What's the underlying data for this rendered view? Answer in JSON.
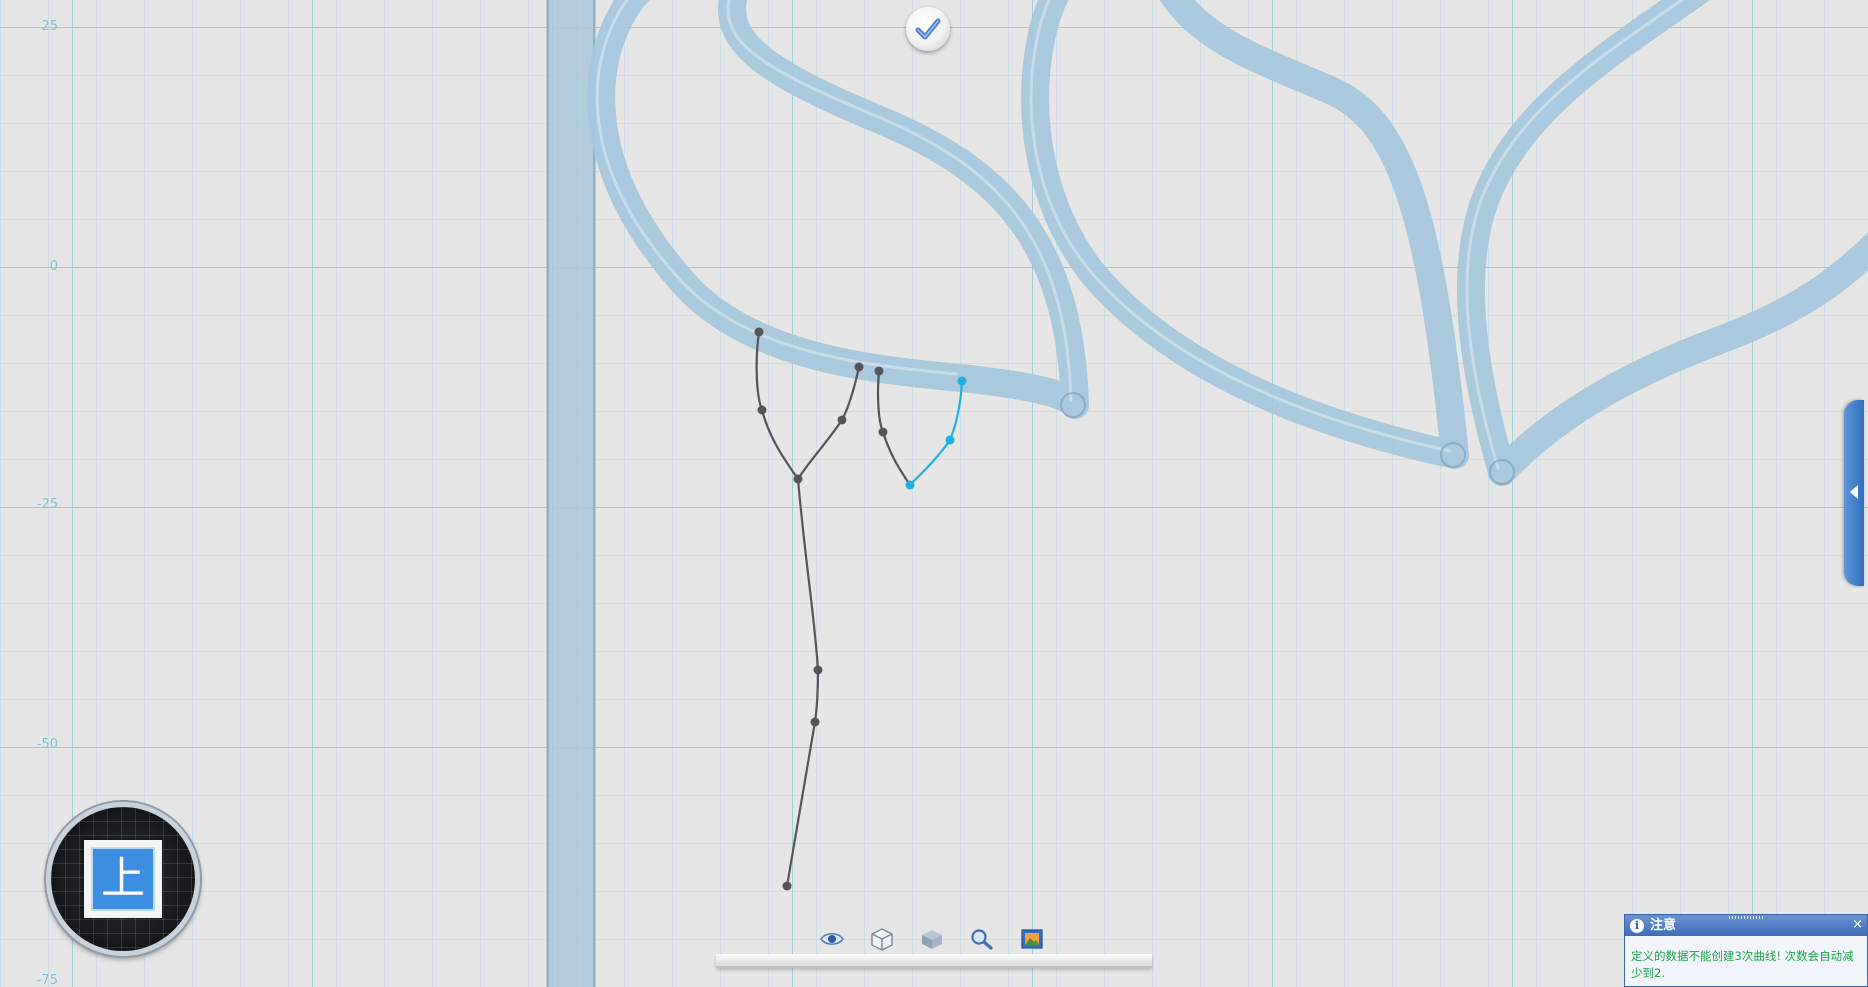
{
  "canvas": {
    "axis_labels": [
      "25",
      "0",
      "-25",
      "-50",
      "-75"
    ],
    "grid_color": "#9fd3e4",
    "major_grid_color": "#7fc6dc",
    "background_color": "#e6e6e6",
    "tube_color": "#a8c8dd",
    "sketch_color": "#555555",
    "active_curve_color": "#1ab3e0"
  },
  "confirm_button": {
    "icon": "checkmark-icon"
  },
  "view_cube": {
    "face_label": "上"
  },
  "toolbar": {
    "tools": [
      {
        "name": "view-eye-tool",
        "icon": "eye-icon"
      },
      {
        "name": "wireframe-cube-tool",
        "icon": "wireframe-cube-icon"
      },
      {
        "name": "solid-cube-tool",
        "icon": "solid-cube-icon"
      },
      {
        "name": "zoom-tool",
        "icon": "magnifier-icon"
      },
      {
        "name": "render-tool",
        "icon": "picture-icon"
      }
    ]
  },
  "side_panel": {
    "icon": "arrow-left-icon"
  },
  "notice": {
    "title": "注意",
    "close": "×",
    "message": "定义的数据不能创建3次曲线! 次数会自动减少到2."
  }
}
